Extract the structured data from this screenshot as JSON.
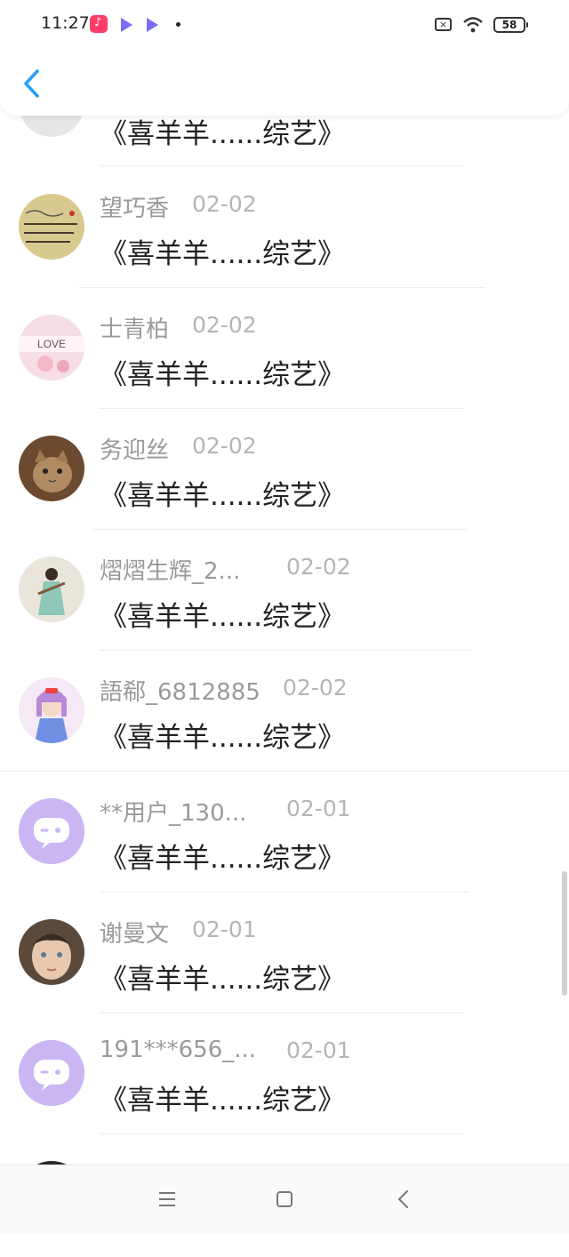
{
  "status_bar": {
    "time": "11:27",
    "icons": [
      "douyin-icon",
      "video-play-icon",
      "video-play-icon",
      "notification-dot"
    ],
    "sim_icon": "no-sim-icon",
    "wifi_icon": "wifi-icon",
    "battery": "58"
  },
  "top_bar": {
    "back_icon": "chevron-left-icon",
    "accent_color": "#2a9df4"
  },
  "comments": [
    {
      "name": "",
      "date": "",
      "message": "《喜羊羊......综艺》",
      "avatar": "avatar-partial"
    },
    {
      "name": "望巧香",
      "date": "02-02",
      "message": "《喜羊羊......综艺》",
      "avatar": "avatar-handwriting"
    },
    {
      "name": "士青柏",
      "date": "02-02",
      "message": "《喜羊羊......综艺》",
      "avatar": "avatar-love-tiles",
      "avatar_text": "LOVE"
    },
    {
      "name": "务迎丝",
      "date": "02-02",
      "message": "《喜羊羊......综艺》",
      "avatar": "avatar-cat"
    },
    {
      "name": "熠熠生辉_2...",
      "date": "02-02",
      "message": "《喜羊羊......综艺》",
      "avatar": "avatar-painting"
    },
    {
      "name": "語郗_6812885",
      "date": "02-02",
      "message": "《喜羊羊......综艺》",
      "avatar": "avatar-anime-girl"
    },
    {
      "name": "**用户_130...",
      "date": "02-01",
      "message": "《喜羊羊......综艺》",
      "avatar": "avatar-default-chat"
    },
    {
      "name": "谢曼文",
      "date": "02-01",
      "message": "《喜羊羊......综艺》",
      "avatar": "avatar-child-face"
    },
    {
      "name": "191***656_...",
      "date": "02-01",
      "message": "《喜羊羊......综艺》",
      "avatar": "avatar-default-chat"
    },
    {
      "name": "",
      "date": "",
      "message": "",
      "avatar": "avatar-partial-dark"
    }
  ],
  "colors": {
    "name": "#9a9a9a",
    "date": "#b5b5b5",
    "message": "#222222",
    "default_avatar_bg": "#cbb6f4"
  },
  "nav_bar": {
    "menu_icon": "menu-icon",
    "home_icon": "home-square-icon",
    "back_icon": "back-triangle-icon"
  }
}
